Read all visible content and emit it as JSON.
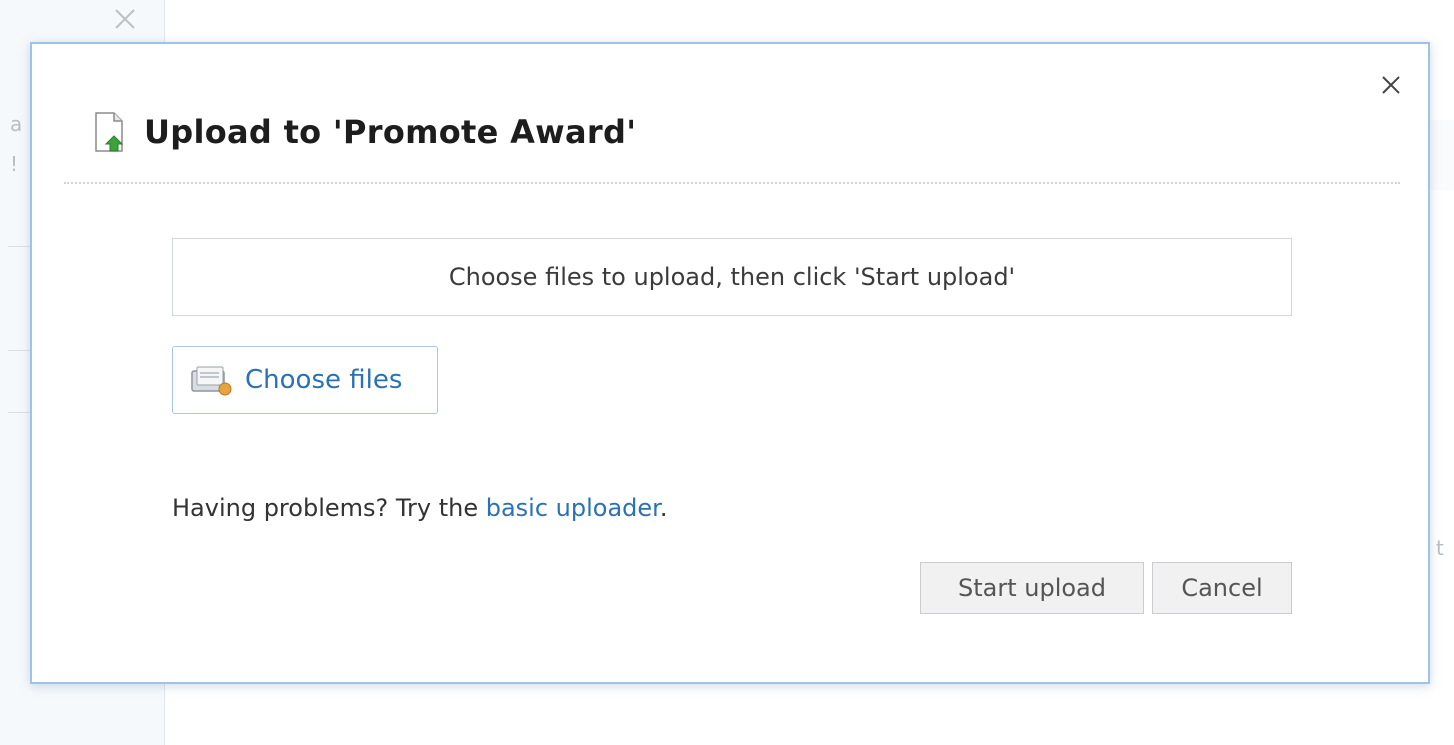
{
  "dialog": {
    "title": "Upload to 'Promote Award'",
    "drop_zone_text": "Choose files to upload, then click 'Start upload'",
    "choose_files_label": "Choose files",
    "help_prefix": "Having problems? Try the ",
    "help_link": "basic uploader",
    "help_suffix": ".",
    "start_upload_label": "Start upload",
    "cancel_label": "Cancel"
  },
  "icons": {
    "close": "close-icon",
    "title": "upload-document-icon",
    "choose_files": "file-folder-icon",
    "background_close": "close-icon"
  },
  "colors": {
    "link": "#2a72b5",
    "modal_border": "#9ec3e6",
    "button_bg": "#f1f1f1"
  },
  "background": {
    "fragments": [
      "a",
      "!",
      "t"
    ]
  }
}
